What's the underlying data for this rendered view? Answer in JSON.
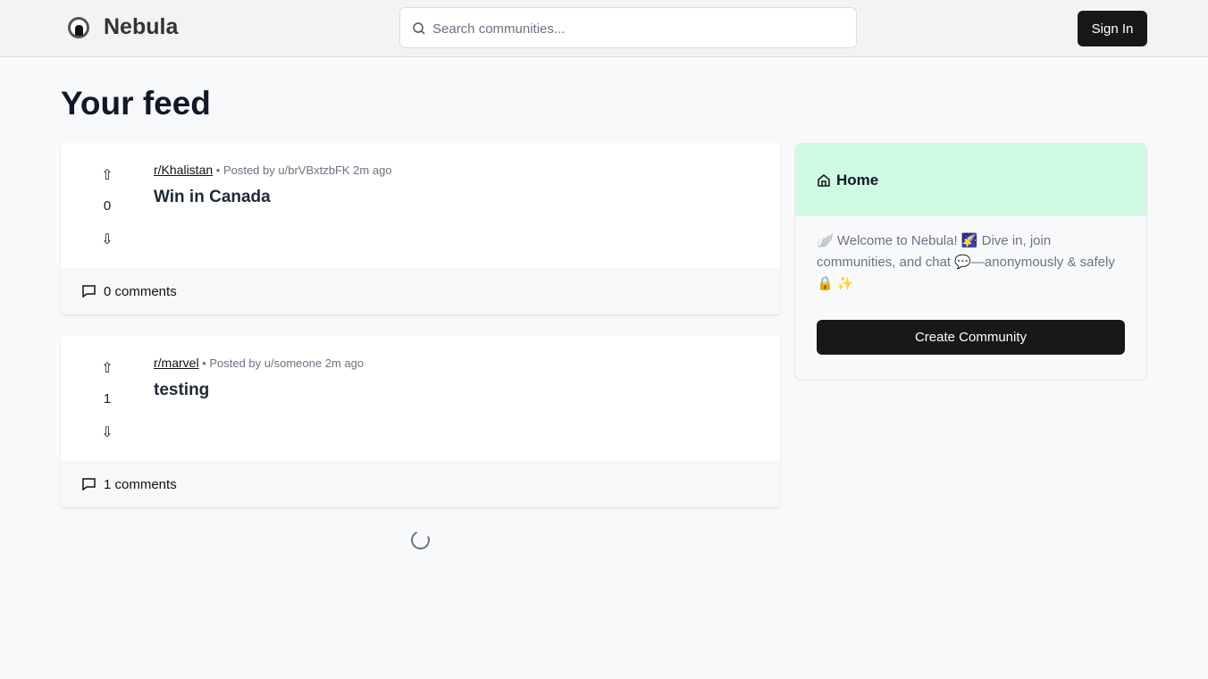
{
  "header": {
    "brand": "Nebula",
    "search_placeholder": "Search communities...",
    "sign_in": "Sign In"
  },
  "feed": {
    "title": "Your feed",
    "posts": [
      {
        "community": "r/Khalistan",
        "meta": "• Posted by u/brVBxtzbFK 2m ago",
        "title": "Win in Canada",
        "score": "0",
        "comments": "0 comments"
      },
      {
        "community": "r/marvel",
        "meta": "• Posted by u/someone 2m ago",
        "title": "testing",
        "score": "1",
        "comments": "1 comments"
      }
    ]
  },
  "sidebar": {
    "title": "Home",
    "description": "🪽 Welcome to Nebula! 🌠 Dive in, join communities, and chat 💬—anonymously & safely 🔒 ✨",
    "create_button": "Create Community"
  }
}
